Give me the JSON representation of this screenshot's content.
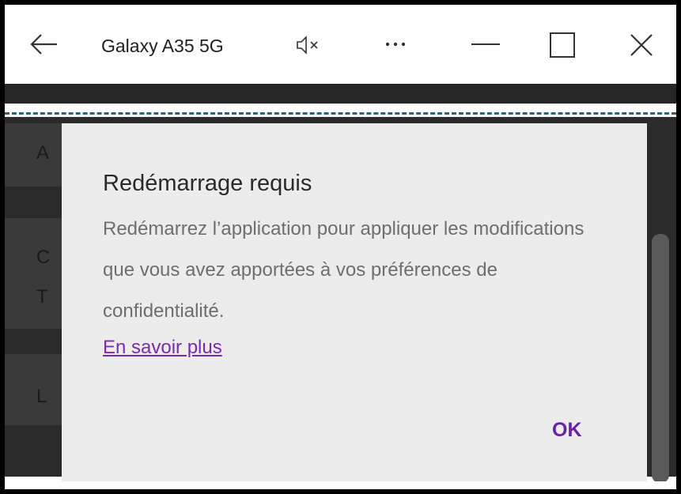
{
  "window": {
    "title": "Galaxy A35 5G",
    "icons": {
      "back": "arrow-left-icon",
      "mute": "speaker-muted-icon",
      "more": "more-horizontal-icon",
      "minimize": "minimize-icon",
      "maximize": "maximize-icon",
      "close": "close-icon"
    }
  },
  "background": {
    "letters": [
      "A",
      "C",
      "T",
      "L"
    ]
  },
  "dialog": {
    "title": "Redémarrage requis",
    "body": "Redémarrez l’application pour appliquer les modifications que vous avez apportées à vos préférences de confidentialité.",
    "link": "En savoir plus",
    "ok_label": "OK",
    "accent_color": "#6a1fb0"
  }
}
